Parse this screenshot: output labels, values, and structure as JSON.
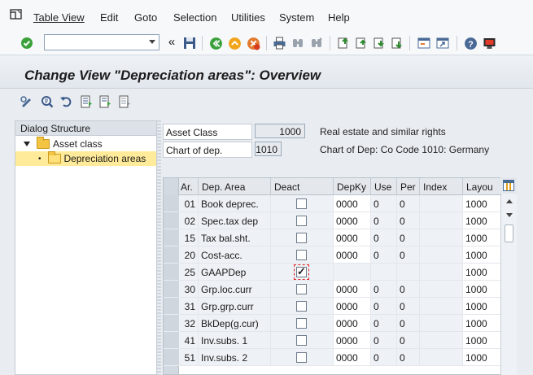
{
  "menu": {
    "items": [
      "Table View",
      "Edit",
      "Goto",
      "Selection",
      "Utilities",
      "System",
      "Help"
    ]
  },
  "toolbar": {
    "command_field_value": "",
    "back_symbol": "«"
  },
  "title": "Change View \"Depreciation areas\": Overview",
  "dialog": {
    "header": "Dialog Structure",
    "tree": [
      {
        "label": "Asset class",
        "level": 0,
        "expanded": true,
        "selected": false
      },
      {
        "label": "Depreciation areas",
        "level": 1,
        "expanded": false,
        "selected": true
      }
    ]
  },
  "header_fields": {
    "asset_class_label": "Asset Class",
    "asset_class_value": "1000",
    "asset_class_desc": "Real estate and similar rights",
    "chart_label": "Chart of dep.",
    "chart_value": "1010",
    "chart_desc": "Chart of Dep: Co Code 1010: Germany"
  },
  "table": {
    "columns": [
      "Ar.",
      "Dep. Area",
      "Deact",
      "DepKy",
      "Use",
      "Per",
      "Index",
      "Layou"
    ],
    "rows": [
      {
        "ar": "01",
        "area": "Book deprec.",
        "deact": false,
        "depky": "0000",
        "use": "0",
        "per": "0",
        "index": "",
        "layout": "1000"
      },
      {
        "ar": "02",
        "area": "Spec.tax dep",
        "deact": false,
        "depky": "0000",
        "use": "0",
        "per": "0",
        "index": "",
        "layout": "1000"
      },
      {
        "ar": "15",
        "area": "Tax bal.sht.",
        "deact": false,
        "depky": "0000",
        "use": "0",
        "per": "0",
        "index": "",
        "layout": "1000"
      },
      {
        "ar": "20",
        "area": "Cost-acc.",
        "deact": false,
        "depky": "0000",
        "use": "0",
        "per": "0",
        "index": "",
        "layout": "1000"
      },
      {
        "ar": "25",
        "area": "GAAPDep",
        "deact": true,
        "depky": "",
        "use": "",
        "per": "",
        "index": "",
        "layout": "1000"
      },
      {
        "ar": "30",
        "area": "Grp.loc.curr",
        "deact": false,
        "depky": "0000",
        "use": "0",
        "per": "0",
        "index": "",
        "layout": "1000"
      },
      {
        "ar": "31",
        "area": "Grp.grp.curr",
        "deact": false,
        "depky": "0000",
        "use": "0",
        "per": "0",
        "index": "",
        "layout": "1000"
      },
      {
        "ar": "32",
        "area": "BkDep(g.cur)",
        "deact": false,
        "depky": "0000",
        "use": "0",
        "per": "0",
        "index": "",
        "layout": "1000"
      },
      {
        "ar": "41",
        "area": "Inv.subs. 1",
        "deact": false,
        "depky": "0000",
        "use": "0",
        "per": "0",
        "index": "",
        "layout": "1000"
      },
      {
        "ar": "51",
        "area": "Inv.subs. 2",
        "deact": false,
        "depky": "0000",
        "use": "0",
        "per": "0",
        "index": "",
        "layout": "1000"
      }
    ]
  },
  "colors": {
    "accent_green": "#3aa13a",
    "folder_yellow": "#f4c543",
    "selection_yellow": "#ffeb99"
  }
}
